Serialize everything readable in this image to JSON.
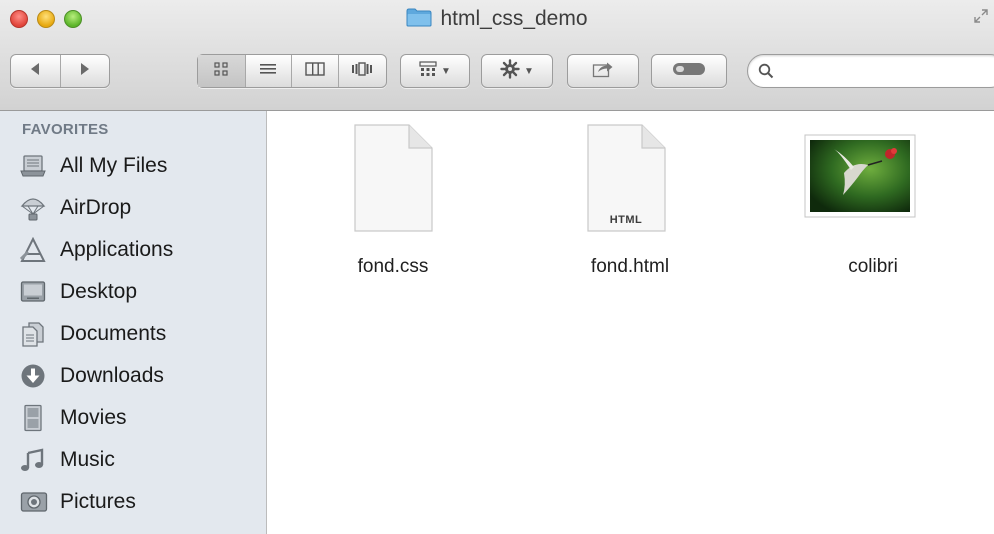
{
  "window": {
    "title": "html_css_demo"
  },
  "toolbar": {
    "back_icon": "chevron-left-icon",
    "forward_icon": "chevron-right-icon",
    "view_modes": [
      "icon-view",
      "list-view",
      "column-view",
      "coverflow-view"
    ],
    "active_view": "icon-view",
    "arrange_icon": "arrange-icon",
    "action_icon": "gear-icon",
    "share_icon": "share-icon",
    "tags_icon": "tag-icon",
    "search": {
      "value": "",
      "placeholder": ""
    }
  },
  "sidebar": {
    "header": "FAVORITES",
    "items": [
      {
        "label": "All My Files",
        "icon": "all-my-files-icon"
      },
      {
        "label": "AirDrop",
        "icon": "airdrop-icon"
      },
      {
        "label": "Applications",
        "icon": "applications-icon"
      },
      {
        "label": "Desktop",
        "icon": "desktop-icon"
      },
      {
        "label": "Documents",
        "icon": "documents-icon"
      },
      {
        "label": "Downloads",
        "icon": "downloads-icon"
      },
      {
        "label": "Movies",
        "icon": "movies-icon"
      },
      {
        "label": "Music",
        "icon": "music-icon"
      },
      {
        "label": "Pictures",
        "icon": "pictures-icon"
      }
    ]
  },
  "files": [
    {
      "name": "fond.css",
      "type_label": "",
      "icon": "document-icon"
    },
    {
      "name": "fond.html",
      "type_label": "HTML",
      "icon": "html-document-icon"
    },
    {
      "name": "colibri",
      "type_label": "",
      "icon": "image-thumbnail-icon"
    }
  ],
  "colors": {
    "sidebar_bg": "#e3e8ee",
    "sidebar_header": "#707a86",
    "folder_blue": "#5ea8dd",
    "close": "#e0443a",
    "minimize": "#e7a80e",
    "zoom": "#5cb52a"
  }
}
